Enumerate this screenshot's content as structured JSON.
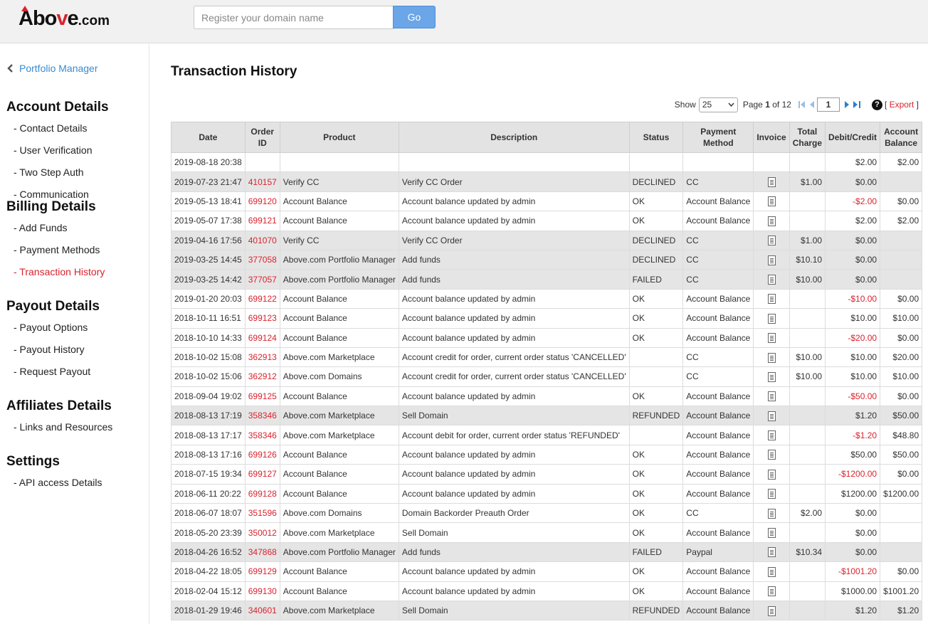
{
  "header": {
    "logo_main": "Abo",
    "logo_v": "v",
    "logo_e": "e",
    "logo_dotcom": ".com",
    "search_placeholder": "Register your domain name",
    "go_label": "Go"
  },
  "sidebar": {
    "back_label": "Portfolio Manager",
    "sections": [
      {
        "title": "Account Details",
        "items": [
          "- Contact Details",
          "- User Verification",
          "- Two Step Auth",
          "- Communication"
        ]
      },
      {
        "title": "Billing Details",
        "items": [
          "- Add Funds",
          "- Payment Methods",
          "- Transaction History"
        ]
      },
      {
        "title": "Payout Details",
        "items": [
          "- Payout Options",
          "- Payout History",
          "- Request Payout"
        ]
      },
      {
        "title": "Affiliates Details",
        "items": [
          "- Links and Resources"
        ]
      },
      {
        "title": "Settings",
        "items": [
          "- API access Details"
        ]
      }
    ],
    "active_item": "- Transaction History"
  },
  "main": {
    "title": "Transaction History",
    "pager": {
      "show_label": "Show",
      "show_value": "25",
      "page_label": "Page",
      "current_page": "1",
      "of_label": "of",
      "total_pages": "12",
      "page_input": "1",
      "export_label": "Export",
      "help_symbol": "?"
    },
    "columns": [
      "Date",
      "Order ID",
      "Product",
      "Description",
      "Status",
      "Payment Method",
      "Invoice",
      "Total Charge",
      "Debit/Credit",
      "Account Balance"
    ],
    "rows": [
      {
        "date": "2019-08-18 20:38",
        "order": "",
        "product": "",
        "desc": "",
        "status": "",
        "method": "",
        "invoice": false,
        "charge": "",
        "debit": "$2.00",
        "balance": "$2.00",
        "shaded": false,
        "neg": false
      },
      {
        "date": "2019-07-23 21:47",
        "order": "410157",
        "product": "Verify CC",
        "desc": "Verify CC Order",
        "status": "DECLINED",
        "method": "CC",
        "invoice": true,
        "charge": "$1.00",
        "debit": "$0.00",
        "balance": "",
        "shaded": true,
        "neg": false
      },
      {
        "date": "2019-05-13 18:41",
        "order": "699120",
        "product": "Account Balance",
        "desc": "Account balance updated by admin",
        "status": "OK",
        "method": "Account Balance",
        "invoice": true,
        "charge": "",
        "debit": "-$2.00",
        "balance": "$0.00",
        "shaded": false,
        "neg": true
      },
      {
        "date": "2019-05-07 17:38",
        "order": "699121",
        "product": "Account Balance",
        "desc": "Account balance updated by admin",
        "status": "OK",
        "method": "Account Balance",
        "invoice": true,
        "charge": "",
        "debit": "$2.00",
        "balance": "$2.00",
        "shaded": false,
        "neg": false
      },
      {
        "date": "2019-04-16 17:56",
        "order": "401070",
        "product": "Verify CC",
        "desc": "Verify CC Order",
        "status": "DECLINED",
        "method": "CC",
        "invoice": true,
        "charge": "$1.00",
        "debit": "$0.00",
        "balance": "",
        "shaded": true,
        "neg": false
      },
      {
        "date": "2019-03-25 14:45",
        "order": "377058",
        "product": "Above.com Portfolio Manager",
        "desc": "Add funds",
        "status": "DECLINED",
        "method": "CC",
        "invoice": true,
        "charge": "$10.10",
        "debit": "$0.00",
        "balance": "",
        "shaded": true,
        "neg": false
      },
      {
        "date": "2019-03-25 14:42",
        "order": "377057",
        "product": "Above.com Portfolio Manager",
        "desc": "Add funds",
        "status": "FAILED",
        "method": "CC",
        "invoice": true,
        "charge": "$10.00",
        "debit": "$0.00",
        "balance": "",
        "shaded": true,
        "neg": false
      },
      {
        "date": "2019-01-20 20:03",
        "order": "699122",
        "product": "Account Balance",
        "desc": "Account balance updated by admin",
        "status": "OK",
        "method": "Account Balance",
        "invoice": true,
        "charge": "",
        "debit": "-$10.00",
        "balance": "$0.00",
        "shaded": false,
        "neg": true
      },
      {
        "date": "2018-10-11 16:51",
        "order": "699123",
        "product": "Account Balance",
        "desc": "Account balance updated by admin",
        "status": "OK",
        "method": "Account Balance",
        "invoice": true,
        "charge": "",
        "debit": "$10.00",
        "balance": "$10.00",
        "shaded": false,
        "neg": false
      },
      {
        "date": "2018-10-10 14:33",
        "order": "699124",
        "product": "Account Balance",
        "desc": "Account balance updated by admin",
        "status": "OK",
        "method": "Account Balance",
        "invoice": true,
        "charge": "",
        "debit": "-$20.00",
        "balance": "$0.00",
        "shaded": false,
        "neg": true
      },
      {
        "date": "2018-10-02 15:08",
        "order": "362913",
        "product": "Above.com Marketplace",
        "desc": "Account credit for order, current order status 'CANCELLED'",
        "status": "",
        "method": "CC",
        "invoice": true,
        "charge": "$10.00",
        "debit": "$10.00",
        "balance": "$20.00",
        "shaded": false,
        "neg": false
      },
      {
        "date": "2018-10-02 15:06",
        "order": "362912",
        "product": "Above.com Domains",
        "desc": "Account credit for order, current order status 'CANCELLED'",
        "status": "",
        "method": "CC",
        "invoice": true,
        "charge": "$10.00",
        "debit": "$10.00",
        "balance": "$10.00",
        "shaded": false,
        "neg": false
      },
      {
        "date": "2018-09-04 19:02",
        "order": "699125",
        "product": "Account Balance",
        "desc": "Account balance updated by admin",
        "status": "OK",
        "method": "Account Balance",
        "invoice": true,
        "charge": "",
        "debit": "-$50.00",
        "balance": "$0.00",
        "shaded": false,
        "neg": true
      },
      {
        "date": "2018-08-13 17:19",
        "order": "358346",
        "product": "Above.com Marketplace",
        "desc": "Sell Domain",
        "status": "REFUNDED",
        "method": "Account Balance",
        "invoice": true,
        "charge": "",
        "debit": "$1.20",
        "balance": "$50.00",
        "shaded": true,
        "neg": false
      },
      {
        "date": "2018-08-13 17:17",
        "order": "358346",
        "product": "Above.com Marketplace",
        "desc": "Account debit for order, current order status 'REFUNDED'",
        "status": "",
        "method": "Account Balance",
        "invoice": true,
        "charge": "",
        "debit": "-$1.20",
        "balance": "$48.80",
        "shaded": false,
        "neg": true
      },
      {
        "date": "2018-08-13 17:16",
        "order": "699126",
        "product": "Account Balance",
        "desc": "Account balance updated by admin",
        "status": "OK",
        "method": "Account Balance",
        "invoice": true,
        "charge": "",
        "debit": "$50.00",
        "balance": "$50.00",
        "shaded": false,
        "neg": false
      },
      {
        "date": "2018-07-15 19:34",
        "order": "699127",
        "product": "Account Balance",
        "desc": "Account balance updated by admin",
        "status": "OK",
        "method": "Account Balance",
        "invoice": true,
        "charge": "",
        "debit": "-$1200.00",
        "balance": "$0.00",
        "shaded": false,
        "neg": true
      },
      {
        "date": "2018-06-11 20:22",
        "order": "699128",
        "product": "Account Balance",
        "desc": "Account balance updated by admin",
        "status": "OK",
        "method": "Account Balance",
        "invoice": true,
        "charge": "",
        "debit": "$1200.00",
        "balance": "$1200.00",
        "shaded": false,
        "neg": false
      },
      {
        "date": "2018-06-07 18:07",
        "order": "351596",
        "product": "Above.com Domains",
        "desc": "Domain Backorder Preauth Order",
        "status": "OK",
        "method": "CC",
        "invoice": true,
        "charge": "$2.00",
        "debit": "$0.00",
        "balance": "",
        "shaded": false,
        "neg": false
      },
      {
        "date": "2018-05-20 23:39",
        "order": "350012",
        "product": "Above.com Marketplace",
        "desc": "Sell Domain",
        "status": "OK",
        "method": "Account Balance",
        "invoice": true,
        "charge": "",
        "debit": "$0.00",
        "balance": "",
        "shaded": false,
        "neg": false
      },
      {
        "date": "2018-04-26 16:52",
        "order": "347868",
        "product": "Above.com Portfolio Manager",
        "desc": "Add funds",
        "status": "FAILED",
        "method": "Paypal",
        "invoice": true,
        "charge": "$10.34",
        "debit": "$0.00",
        "balance": "",
        "shaded": true,
        "neg": false
      },
      {
        "date": "2018-04-22 18:05",
        "order": "699129",
        "product": "Account Balance",
        "desc": "Account balance updated by admin",
        "status": "OK",
        "method": "Account Balance",
        "invoice": true,
        "charge": "",
        "debit": "-$1001.20",
        "balance": "$0.00",
        "shaded": false,
        "neg": true
      },
      {
        "date": "2018-02-04 15:12",
        "order": "699130",
        "product": "Account Balance",
        "desc": "Account balance updated by admin",
        "status": "OK",
        "method": "Account Balance",
        "invoice": true,
        "charge": "",
        "debit": "$1000.00",
        "balance": "$1001.20",
        "shaded": false,
        "neg": false
      },
      {
        "date": "2018-01-29 19:46",
        "order": "340601",
        "product": "Above.com Marketplace",
        "desc": "Sell Domain",
        "status": "REFUNDED",
        "method": "Account Balance",
        "invoice": true,
        "charge": "",
        "debit": "$1.20",
        "balance": "$1.20",
        "shaded": true,
        "neg": false
      }
    ]
  },
  "colors": {
    "accent_red": "#d9232e",
    "link_blue": "#3a8ad2",
    "go_button": "#6aa6e8"
  },
  "icons": [
    "chevron-left-icon",
    "first-page-icon",
    "prev-page-icon",
    "next-page-icon",
    "last-page-icon",
    "help-icon",
    "invoice-icon",
    "select-caret-icon"
  ]
}
